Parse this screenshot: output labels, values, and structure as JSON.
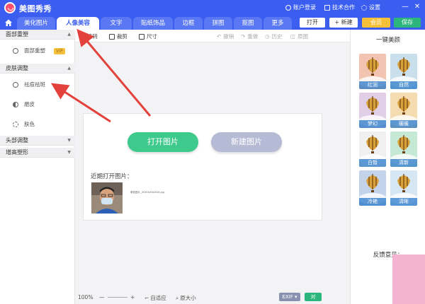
{
  "app": {
    "title": "美图秀秀",
    "account_login": "账户登录",
    "tech_coop": "技术合作",
    "settings": "设置",
    "minimize_glyph": "—",
    "close_glyph": "✕"
  },
  "tabs": [
    {
      "label": "美化图片"
    },
    {
      "label": "人像美容"
    },
    {
      "label": "文字"
    },
    {
      "label": "贴纸饰品"
    },
    {
      "label": "边框"
    },
    {
      "label": "拼图"
    },
    {
      "label": "抠图"
    },
    {
      "label": "更多"
    }
  ],
  "top_buttons": {
    "open": "打开",
    "new": "+ 新建",
    "vip": "会员",
    "save": "保存"
  },
  "left_panel": {
    "sections": [
      {
        "label": "面部重塑",
        "arrow": "▲"
      },
      {
        "label": "皮肤调整",
        "arrow": "▲"
      },
      {
        "label": "头部调整",
        "arrow": "▼"
      },
      {
        "label": "增高塑形",
        "arrow": "▼"
      }
    ],
    "items": [
      {
        "label": "面部重塑",
        "badge": "VIP"
      },
      {
        "label": "祛痘祛斑"
      },
      {
        "label": "磨皮"
      },
      {
        "label": "肤色"
      }
    ]
  },
  "toolbar": {
    "rotate": "旋转",
    "crop": "裁剪",
    "size": "尺寸",
    "undo": "撤销",
    "redo": "重做",
    "history": "历史",
    "original": "原图"
  },
  "canvas": {
    "open_image": "打开图片",
    "new_image": "新建图片",
    "recent_label": "近期打开图片：",
    "recent_caption": "微信图片_2020XXXXXXX.jpg"
  },
  "statusbar": {
    "zoom": "100%",
    "minus": "—",
    "plus": "+",
    "fit": "自适应",
    "original_size": "原大小",
    "exif": "EXIF ▾",
    "compare": "对"
  },
  "right_panel": {
    "title": "一键美颜",
    "effects": [
      "红润",
      "自然",
      "梦幻",
      "暖暖",
      "白皙",
      "清新",
      "冷艳",
      "清晰"
    ],
    "feedback": "反馈意见："
  },
  "colors": {
    "brand_blue": "#3b5ef0",
    "open_green": "#3fca8d",
    "new_gray": "#b6bbd5",
    "vip_gold": "#f5c13b",
    "save_green": "#2cb67d",
    "arrow_red": "#e3413b"
  }
}
